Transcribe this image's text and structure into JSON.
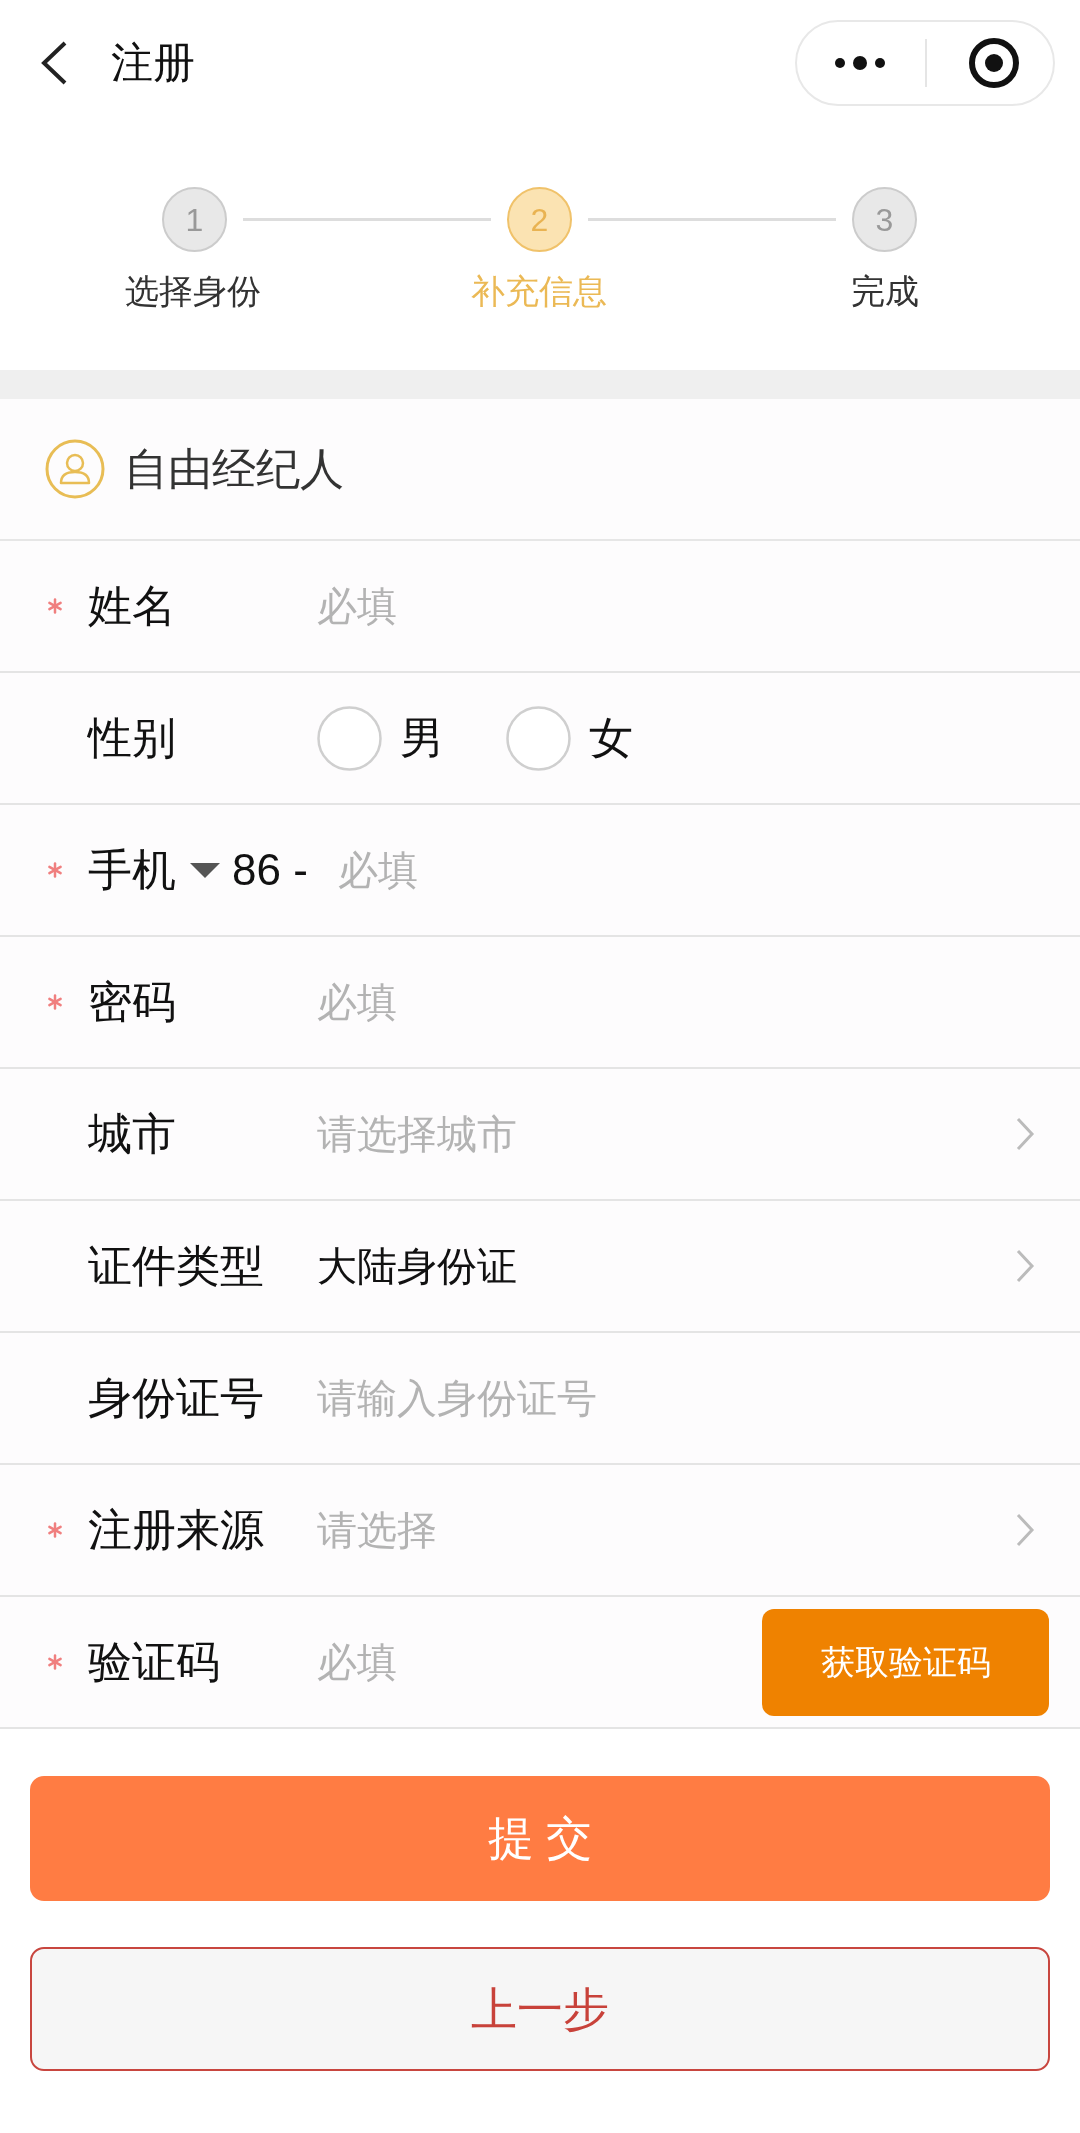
{
  "nav_bar": {
    "title": "注册"
  },
  "steps": [
    {
      "number": "1",
      "label": "选择身份",
      "selected": false
    },
    {
      "number": "2",
      "label": "补充信息",
      "selected": true
    },
    {
      "number": "3",
      "label": "完成",
      "selected": false
    }
  ],
  "identity": {
    "label": "自由经纪人"
  },
  "form": {
    "fields": [
      {
        "kind": "text",
        "label": "姓名",
        "required": true,
        "placeholder": "必填"
      },
      {
        "kind": "radio",
        "label": "性别",
        "required": false,
        "options": [
          {
            "label": "男",
            "selected": false
          },
          {
            "label": "女",
            "selected": false
          }
        ]
      },
      {
        "kind": "phone",
        "label": "手机",
        "required": true,
        "prefix": "86 -",
        "placeholder": "必填"
      },
      {
        "kind": "text",
        "label": "密码",
        "required": true,
        "placeholder": "必填"
      },
      {
        "kind": "select",
        "label": "城市",
        "required": false,
        "placeholder": "请选择城市"
      },
      {
        "kind": "select",
        "label": "证件类型",
        "required": false,
        "value": "大陆身份证"
      },
      {
        "kind": "text",
        "label": "身份证号",
        "required": false,
        "placeholder": "请输入身份证号"
      },
      {
        "kind": "select",
        "label": "注册来源",
        "required": true,
        "placeholder": "请选择"
      },
      {
        "kind": "code",
        "label": "验证码",
        "required": true,
        "placeholder": "必填",
        "button": "获取验证码"
      }
    ]
  },
  "buttons": [
    {
      "kind": "primary",
      "label": "提 交"
    },
    {
      "kind": "secondary",
      "label": "上一步"
    }
  ]
}
